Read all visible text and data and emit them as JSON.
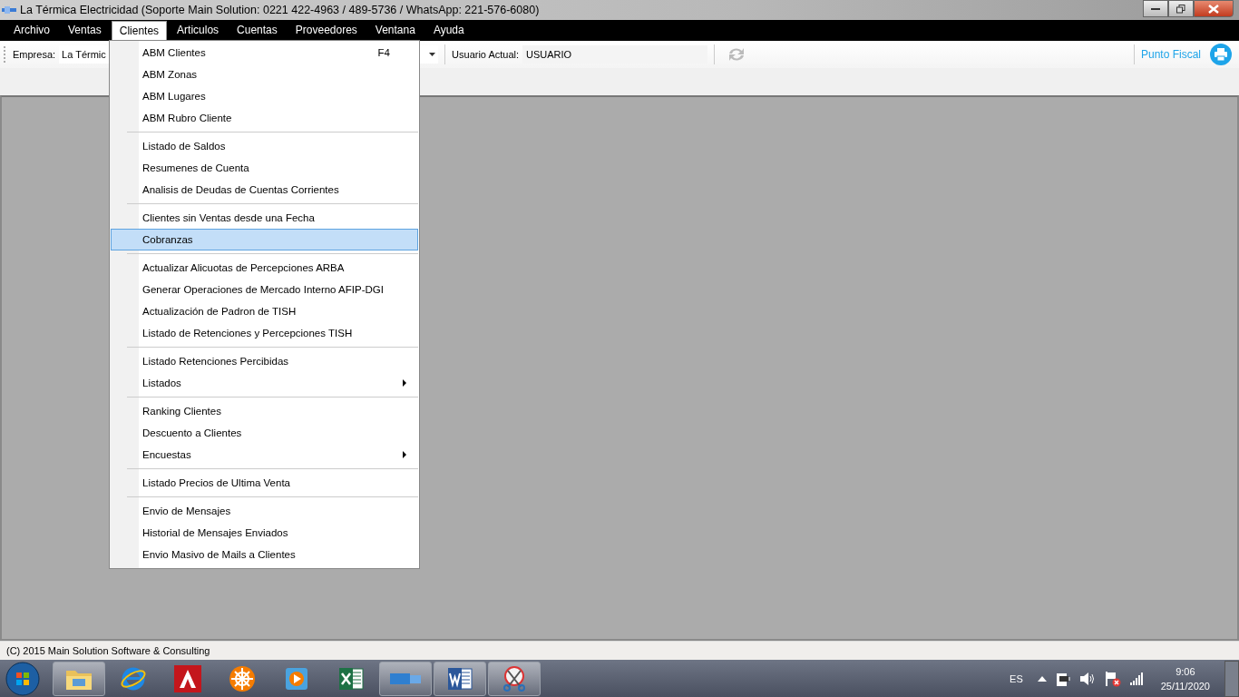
{
  "window": {
    "title": "La Térmica Electricidad (Soporte Main Solution: 0221 422-4963 / 489-5736 / WhatsApp: 221-576-6080)"
  },
  "menu_bar": [
    {
      "label": "Archivo",
      "selected": false
    },
    {
      "label": "Ventas",
      "selected": false
    },
    {
      "label": "Clientes",
      "selected": true
    },
    {
      "label": "Articulos",
      "selected": false
    },
    {
      "label": "Cuentas",
      "selected": false
    },
    {
      "label": "Proveedores",
      "selected": false
    },
    {
      "label": "Ventana",
      "selected": false
    },
    {
      "label": "Ayuda",
      "selected": false
    }
  ],
  "toolbar": {
    "empresa_label": "Empresa:",
    "empresa_value": "La Térmic",
    "usuario_label": "Usuario Actual:",
    "usuario_value": "USUARIO",
    "punto_fiscal": "Punto Fiscal"
  },
  "dropdown": {
    "groups": [
      [
        {
          "label": "ABM Clientes",
          "shortcut": "F4",
          "submenu": false,
          "selected": false
        },
        {
          "label": "ABM Zonas",
          "submenu": false,
          "selected": false
        },
        {
          "label": "ABM Lugares",
          "submenu": false,
          "selected": false
        },
        {
          "label": "ABM Rubro Cliente",
          "submenu": false,
          "selected": false
        }
      ],
      [
        {
          "label": "Listado de Saldos",
          "submenu": false,
          "selected": false
        },
        {
          "label": "Resumenes de Cuenta",
          "submenu": false,
          "selected": false
        },
        {
          "label": "Analisis de Deudas de Cuentas Corrientes",
          "submenu": false,
          "selected": false
        }
      ],
      [
        {
          "label": "Clientes sin Ventas desde una Fecha",
          "submenu": false,
          "selected": false
        },
        {
          "label": "Cobranzas",
          "submenu": false,
          "selected": true
        }
      ],
      [
        {
          "label": "Actualizar Alicuotas de Percepciones ARBA",
          "submenu": false,
          "selected": false
        },
        {
          "label": "Generar Operaciones de Mercado Interno AFIP-DGI",
          "submenu": false,
          "selected": false
        },
        {
          "label": "Actualización de Padron de TISH",
          "submenu": false,
          "selected": false
        },
        {
          "label": "Listado de Retenciones y Percepciones TISH",
          "submenu": false,
          "selected": false
        }
      ],
      [
        {
          "label": "Listado Retenciones Percibidas",
          "submenu": false,
          "selected": false
        },
        {
          "label": "Listados",
          "submenu": true,
          "selected": false
        }
      ],
      [
        {
          "label": "Ranking Clientes",
          "submenu": false,
          "selected": false
        },
        {
          "label": "Descuento a Clientes",
          "submenu": false,
          "selected": false
        },
        {
          "label": "Encuestas",
          "submenu": true,
          "selected": false
        }
      ],
      [
        {
          "label": "Listado Precios de Ultima Venta",
          "submenu": false,
          "selected": false
        }
      ],
      [
        {
          "label": "Envio de Mensajes",
          "submenu": false,
          "selected": false
        },
        {
          "label": "Historial de Mensajes Enviados",
          "submenu": false,
          "selected": false
        },
        {
          "label": "Envio Masivo de Mails a Clientes",
          "submenu": false,
          "selected": false
        }
      ]
    ]
  },
  "status_bar": "(C) 2015 Main Solution Software & Consulting",
  "taskbar": {
    "apps": [
      {
        "kind": "folder",
        "open": true
      },
      {
        "kind": "browser",
        "open": false
      },
      {
        "kind": "cad",
        "open": false
      },
      {
        "kind": "wheel",
        "open": false
      },
      {
        "kind": "player",
        "open": false
      },
      {
        "kind": "sheet",
        "open": false
      },
      {
        "kind": "badge",
        "open": true
      },
      {
        "kind": "word",
        "open": true
      },
      {
        "kind": "scissors",
        "open": true
      }
    ],
    "language": "ES",
    "time": "9:06",
    "date": "25/11/2020"
  }
}
